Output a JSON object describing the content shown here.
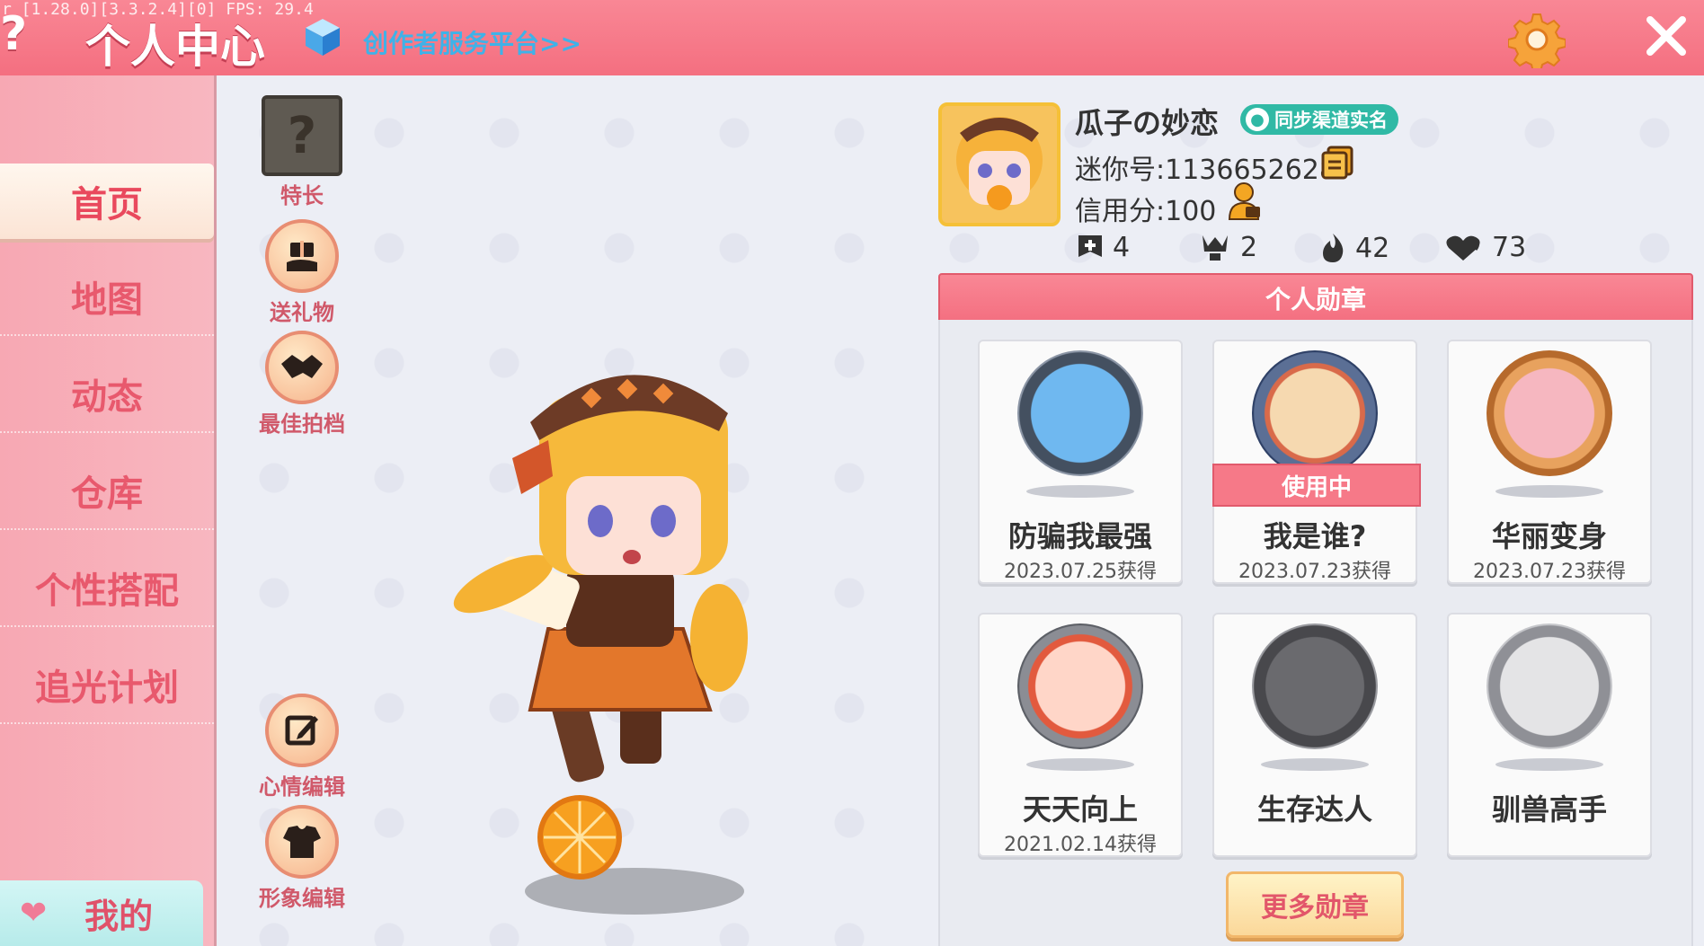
{
  "topbar": {
    "debug_text": "r [1.28.0][3.3.2.4][0] FPS: 29.4",
    "help_label": "?",
    "title": "个人中心",
    "creator_link": "创作者服务平台>>"
  },
  "nav": {
    "items": [
      {
        "label": "首页"
      },
      {
        "label": "地图"
      },
      {
        "label": "动态"
      },
      {
        "label": "仓库"
      },
      {
        "label": "个性搭配"
      },
      {
        "label": "追光计划"
      }
    ],
    "mine_label": "我的"
  },
  "side_actions": [
    {
      "label": "特长",
      "icon": "question-box-icon"
    },
    {
      "label": "送礼物",
      "icon": "gift-hand-icon"
    },
    {
      "label": "最佳拍档",
      "icon": "handshake-icon"
    },
    {
      "label": "心情编辑",
      "icon": "edit-icon"
    },
    {
      "label": "形象编辑",
      "icon": "outfit-icon"
    }
  ],
  "profile": {
    "username": "瓜子の妙恋",
    "realname_badge": "同步渠道实名",
    "mini_id": "迷你号:1136652628",
    "credit": "信用分:100",
    "stats": [
      {
        "icon": "plus-flag-icon",
        "value": "4"
      },
      {
        "icon": "trophy-cup-icon",
        "value": "2"
      },
      {
        "icon": "flame-icon",
        "value": "42"
      },
      {
        "icon": "heart-icon",
        "value": "73"
      }
    ]
  },
  "medals": {
    "header": "个人勋章",
    "items": [
      {
        "name": "防骗我最强",
        "date": "2023.07.25获得",
        "in_use": ""
      },
      {
        "name": "我是谁?",
        "date": "2023.07.23获得",
        "in_use": "使用中"
      },
      {
        "name": "华丽变身",
        "date": "2023.07.23获得",
        "in_use": ""
      },
      {
        "name": "天天向上",
        "date": "2021.02.14获得",
        "in_use": ""
      },
      {
        "name": "生存达人",
        "date": "",
        "in_use": ""
      },
      {
        "name": "驯兽高手",
        "date": "",
        "in_use": ""
      }
    ],
    "more_button": "更多勋章"
  },
  "colors": {
    "accent": "#f46f80",
    "nav_bg": "#f7a8b3",
    "badge_teal": "#30b9a5",
    "link_blue": "#3fb2e8"
  }
}
